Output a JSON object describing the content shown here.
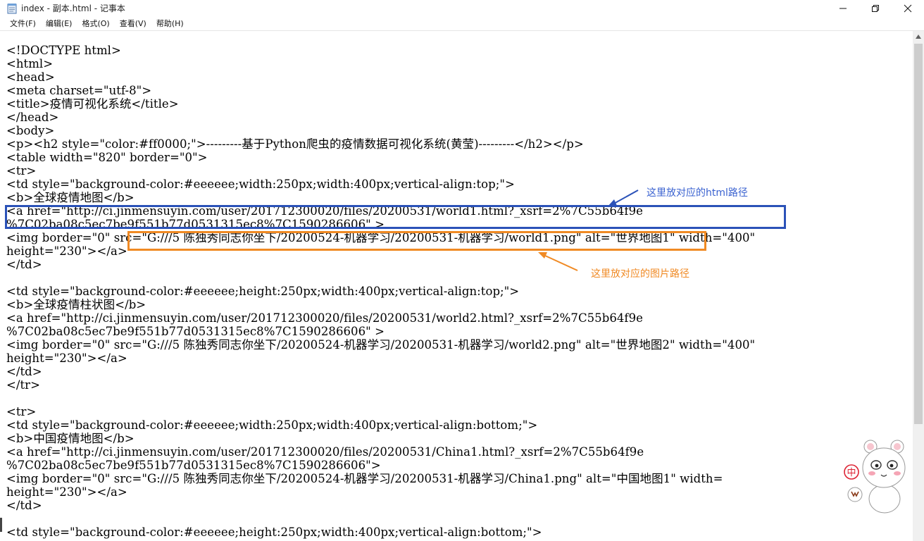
{
  "window": {
    "title": "index - 副本.html - 记事本",
    "controls": {
      "minimize": "—",
      "maximize": "☐",
      "close": "✕"
    }
  },
  "menu": {
    "items": [
      "文件(F)",
      "编辑(E)",
      "格式(O)",
      "查看(V)",
      "帮助(H)"
    ]
  },
  "editor": {
    "lines": [
      "<!DOCTYPE html>",
      "<html>",
      "<head>",
      "<meta charset=\"utf-8\">",
      "<title>疫情可视化系统</title>",
      "</head>",
      "<body>",
      "<p><h2 style=\"color:#ff0000;\">---------基于Python爬虫的疫情数据可视化系统(黄莹)---------</h2></p>",
      "<table width=\"820\" border=\"0\">",
      "<tr>",
      "<td style=\"background-color:#eeeeee;width:250px;width:400px;vertical-align:top;\">",
      "<b>全球疫情地图</b>",
      "<a href=\"http://ci.jinmensuyin.com/user/201712300020/files/20200531/world1.html?_xsrf=2%7C55b64f9e",
      "%7C02ba08c5ec7be9f551b77d0531315ec8%7C1590286606\" >",
      "<img border=\"0\" src=\"G:///5 陈独秀同志你坐下/20200524-机器学习/20200531-机器学习/world1.png\" alt=\"世界地图1\" width=\"400\"",
      "height=\"230\"></a>",
      "</td>",
      "",
      "<td style=\"background-color:#eeeeee;height:250px;width:400px;vertical-align:top;\">",
      "<b>全球疫情柱状图</b>",
      "<a href=\"http://ci.jinmensuyin.com/user/201712300020/files/20200531/world2.html?_xsrf=2%7C55b64f9e",
      "%7C02ba08c5ec7be9f551b77d0531315ec8%7C1590286606\" >",
      "<img border=\"0\" src=\"G:///5 陈独秀同志你坐下/20200524-机器学习/20200531-机器学习/world2.png\" alt=\"世界地图2\" width=\"400\"",
      "height=\"230\"></a>",
      "</td>",
      "</tr>",
      "",
      "<tr>",
      "<td style=\"background-color:#eeeeee;width:250px;width:400px;vertical-align:bottom;\">",
      "<b>中国疫情地图</b>",
      "<a href=\"http://ci.jinmensuyin.com/user/201712300020/files/20200531/China1.html?_xsrf=2%7C55b64f9e",
      "%7C02ba08c5ec7be9f551b77d0531315ec8%7C1590286606\">",
      "<img border=\"0\" src=\"G:///5 陈独秀同志你坐下/20200524-机器学习/20200531-机器学习/China1.png\" alt=\"中国地图1\" width=",
      "height=\"230\"></a>",
      "</td>",
      "",
      "<td style=\"background-color:#eeeeee;height:250px;width:400px;vertical-align:bottom;\">"
    ]
  },
  "annotations": {
    "html_path_label": "这里放对应的html路径",
    "image_path_label": "这里放对应的图片路径"
  },
  "sticker": {
    "badge_text": "中"
  },
  "colors": {
    "annotation_blue": "#2b52b8",
    "annotation_orange": "#f08a24"
  }
}
